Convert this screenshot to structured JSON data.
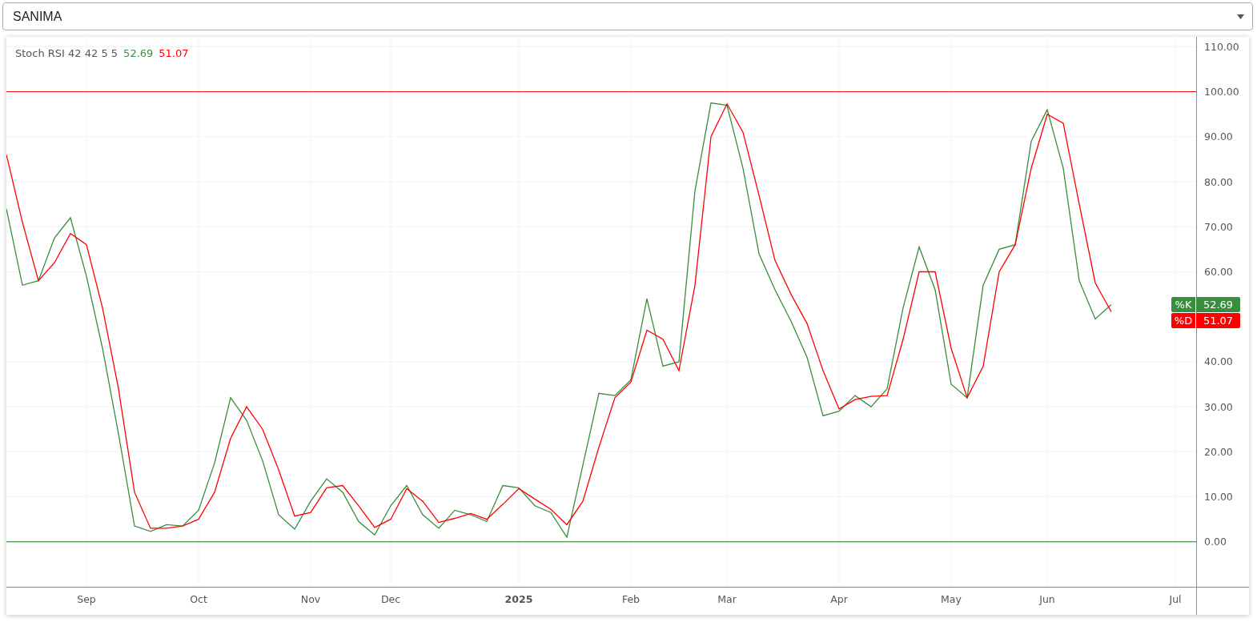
{
  "symbol_select": {
    "value": "SANIMA"
  },
  "legend": {
    "indicator": "Stoch RSI 42 42 5 5",
    "k_value": "52.69",
    "d_value": "51.07"
  },
  "price_badges": [
    {
      "value": "52.69"
    },
    {
      "value": "51.07"
    }
  ],
  "chart_data": {
    "type": "line",
    "categories": [
      null,
      null,
      null,
      null,
      null,
      "Sep",
      null,
      null,
      null,
      null,
      null,
      null,
      "Oct",
      null,
      null,
      null,
      null,
      null,
      null,
      "Nov",
      null,
      null,
      null,
      null,
      "Dec",
      null,
      null,
      null,
      null,
      null,
      null,
      null,
      "2025",
      null,
      null,
      null,
      null,
      null,
      null,
      "Feb",
      null,
      null,
      null,
      null,
      null,
      "Mar",
      null,
      null,
      null,
      null,
      null,
      null,
      "Apr",
      null,
      null,
      null,
      null,
      null,
      null,
      "May",
      null,
      null,
      null,
      null,
      null,
      "Jun",
      null,
      null,
      null,
      null,
      null,
      null,
      null,
      "Jul",
      null
    ],
    "series": [
      {
        "name": "%K",
        "color": "#388e3c",
        "values": [
          74,
          57,
          58,
          67.5,
          72,
          59,
          43,
          24,
          3.5,
          2.3,
          3.8,
          3.5,
          7,
          17.5,
          32,
          27,
          18,
          6,
          2.8,
          9,
          14,
          11,
          4.5,
          1.5,
          8,
          12.5,
          6,
          3,
          7,
          6,
          4.5,
          12.5,
          12,
          8,
          6.5,
          1,
          17,
          33,
          32.5,
          36,
          54,
          39,
          40,
          78,
          97.5,
          97,
          83,
          64,
          56,
          49,
          41,
          28,
          29,
          32.5,
          30,
          34,
          52,
          65.5,
          56,
          35,
          32,
          57,
          65,
          66,
          89,
          96,
          83,
          58,
          49.5,
          52.7,
          null,
          null,
          null,
          null,
          null
        ]
      },
      {
        "name": "%D",
        "color": "#ff0000",
        "values": [
          86,
          71,
          58,
          62,
          68.5,
          66,
          52,
          34,
          11,
          3,
          3,
          3.5,
          5,
          11,
          23,
          30,
          25,
          16,
          5.7,
          6.5,
          12,
          12.5,
          8,
          3.2,
          5,
          11.8,
          9,
          4.3,
          5.2,
          6.3,
          5,
          8.3,
          11.8,
          9.5,
          7.2,
          3.8,
          9,
          21,
          32,
          35.5,
          47,
          45,
          38,
          57,
          90,
          97.3,
          91,
          77,
          62.5,
          55,
          48.5,
          38,
          29.5,
          31.6,
          32.3,
          32.5,
          45,
          60,
          60,
          43,
          32,
          39,
          60,
          66,
          83,
          95,
          93,
          75,
          57.5,
          51.1,
          null,
          null,
          null,
          null,
          null
        ]
      }
    ],
    "ylim": [
      -10,
      112.2
    ],
    "yticks": [
      {
        "value": 0,
        "label": "0.00"
      },
      {
        "value": 10,
        "label": "10.00"
      },
      {
        "value": 20,
        "label": "20.00"
      },
      {
        "value": 30,
        "label": "30.00"
      },
      {
        "value": 40,
        "label": "40.00"
      },
      {
        "value": 60,
        "label": "60.00"
      },
      {
        "value": 70,
        "label": "70.00"
      },
      {
        "value": 80,
        "label": "80.00"
      },
      {
        "value": 90,
        "label": "90.00"
      },
      {
        "value": 100,
        "label": "100.00"
      },
      {
        "value": 110,
        "label": "110.00"
      }
    ],
    "grid": true,
    "legend": "right",
    "ref_lines": [
      {
        "axis": "y",
        "value": 100,
        "color": "#ff0000"
      },
      {
        "axis": "y",
        "value": 0,
        "color": "#1b7a1b"
      }
    ]
  }
}
